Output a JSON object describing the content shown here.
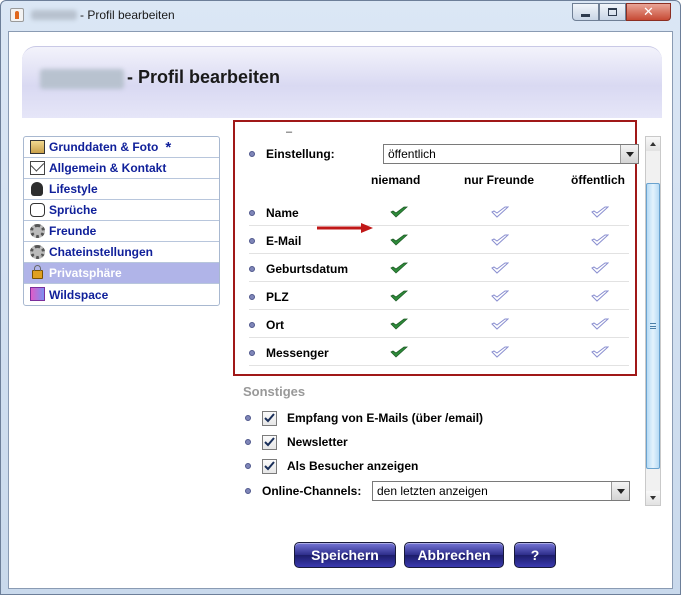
{
  "window": {
    "title": "- Profil bearbeiten",
    "close_label": "✕"
  },
  "header": {
    "title": "- Profil bearbeiten"
  },
  "sidebar": {
    "items": [
      {
        "label": "Grunddaten & Foto",
        "icon": "photo-icon"
      },
      {
        "label": "Allgemein & Kontakt",
        "icon": "envelope-icon"
      },
      {
        "label": "Lifestyle",
        "icon": "person-icon"
      },
      {
        "label": "Sprüche",
        "icon": "speech-bubble-icon"
      },
      {
        "label": "Freunde",
        "icon": "gear-icon"
      },
      {
        "label": "Chateinstellungen",
        "icon": "gear-icon"
      },
      {
        "label": "Privatsphäre",
        "icon": "lock-icon"
      },
      {
        "label": "Wildspace",
        "icon": "wildspace-icon"
      }
    ],
    "star": "*",
    "active_index": 6
  },
  "privacy": {
    "dash": "–",
    "setting_label": "Einstellung:",
    "setting_value": "öffentlich",
    "columns": [
      "niemand",
      "nur Freunde",
      "öffentlich"
    ],
    "rows": [
      {
        "label": "Name",
        "selected": 0
      },
      {
        "label": "E-Mail",
        "selected": 0
      },
      {
        "label": "Geburtsdatum",
        "selected": 0
      },
      {
        "label": "PLZ",
        "selected": 0
      },
      {
        "label": "Ort",
        "selected": 0
      },
      {
        "label": "Messenger",
        "selected": 0
      }
    ],
    "highlight_color": "#a01818",
    "check_selected_color": "#2e8b3a",
    "check_unselected_color": "#8a8fd0"
  },
  "misc": {
    "title": "Sonstiges",
    "options": [
      {
        "label": "Empfang von E-Mails (über /email)",
        "checked": true
      },
      {
        "label": "Newsletter",
        "checked": true
      },
      {
        "label": "Als Besucher anzeigen",
        "checked": true
      }
    ],
    "channels_label": "Online-Channels:",
    "channels_value": "den letzten anzeigen"
  },
  "buttons": {
    "save": "Speichern",
    "cancel": "Abbrechen",
    "help": "?"
  }
}
